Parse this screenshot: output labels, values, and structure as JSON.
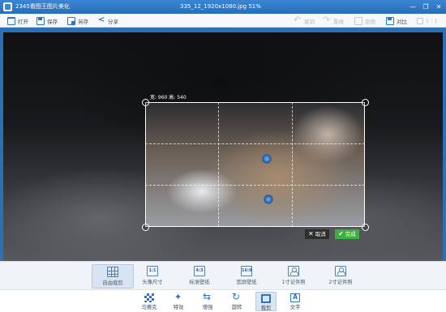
{
  "titlebar": {
    "app_name": "2345看图王图片美化",
    "file_title": "335_12_1920x1080.jpg  51%",
    "buttons": {
      "minimize": "—",
      "restore": "❐",
      "close": "✕"
    }
  },
  "toolbar": {
    "open": "打开",
    "save": "保存",
    "save_as": "另存",
    "share": "分享",
    "undo": "撤销",
    "redo": "重做",
    "original": "原图",
    "compare": "对比",
    "actual_size": "1 : 1"
  },
  "crop": {
    "size_label": "宽: 960  高: 540",
    "cancel": "取消",
    "done": "完成"
  },
  "crop_options": [
    {
      "label": "自由裁剪",
      "icon": "grid-icon",
      "active": true
    },
    {
      "label": "头像尺寸",
      "icon_text": "1:1"
    },
    {
      "label": "标准壁纸",
      "icon_text": "4:3"
    },
    {
      "label": "宽屏壁纸",
      "icon_text": "16:9"
    },
    {
      "label": "1寸证件照",
      "icon": "person-icon"
    },
    {
      "label": "2寸证件照",
      "icon": "person-icon"
    }
  ],
  "bottom_tools": [
    {
      "label": "马赛克",
      "icon": "mosaic-icon"
    },
    {
      "label": "特效",
      "icon": "effect-icon"
    },
    {
      "label": "增强",
      "icon": "enhance-icon"
    },
    {
      "label": "旋转",
      "icon": "rotate-icon"
    },
    {
      "label": "裁剪",
      "icon": "crop-icon",
      "active": true
    },
    {
      "label": "文字",
      "icon": "text-icon"
    }
  ],
  "colors": {
    "titlebar": "#2f74c0",
    "done_button": "#3bb040",
    "canvas_bg": "#36393f"
  }
}
